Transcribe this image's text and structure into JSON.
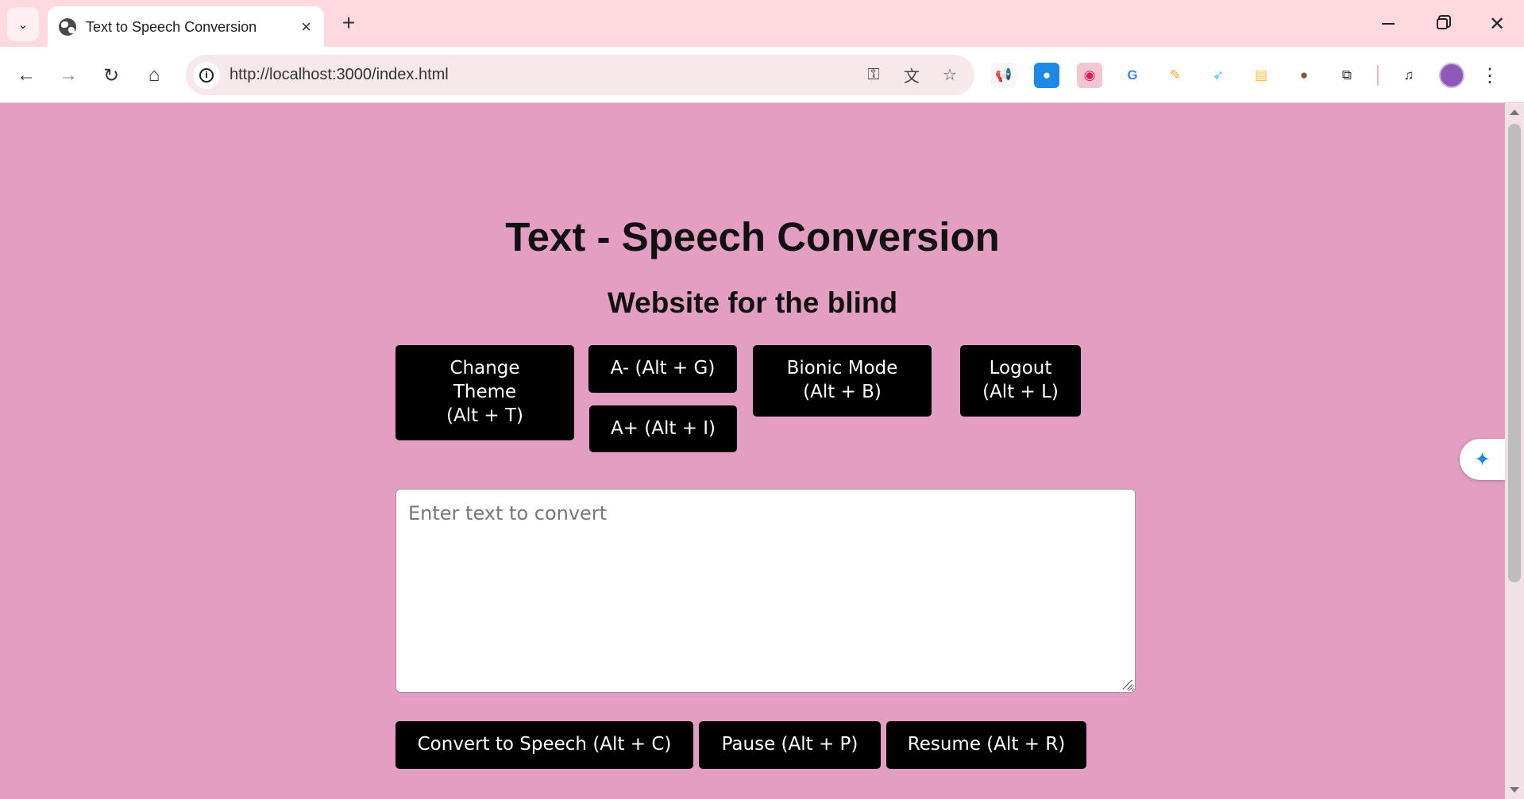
{
  "browser": {
    "tab_title": "Text to Speech Conversion",
    "url": "http://localhost:3000/index.html",
    "icons": {
      "tab_search": "chevron-down-icon",
      "close_tab": "close-icon",
      "new_tab": "plus-icon",
      "back": "arrow-left-icon",
      "forward": "arrow-right-icon",
      "reload": "reload-icon",
      "home": "home-icon",
      "site_info": "info-icon",
      "passwords": "key-icon",
      "translate": "translate-icon",
      "bookmark": "star-icon",
      "menu": "kebab-menu-icon"
    },
    "extensions": [
      {
        "name": "megaphone-extension-icon",
        "glyph": "📢",
        "color": "#ffffff"
      },
      {
        "name": "water-drop-extension-icon",
        "glyph": "💧",
        "color": "#1e88e5"
      },
      {
        "name": "lips-extension-icon",
        "glyph": "👄",
        "color": "#ffffff"
      },
      {
        "name": "google-translate-extension-icon",
        "glyph": "G",
        "color": "#4285f4"
      },
      {
        "name": "highlighter-extension-icon",
        "glyph": "🖍",
        "color": "#ffffff"
      },
      {
        "name": "bird-extension-icon",
        "glyph": "🐦",
        "color": "#ffffff"
      },
      {
        "name": "notes-extension-icon",
        "glyph": "📝",
        "color": "#ffffff"
      },
      {
        "name": "cookie-extension-icon",
        "glyph": "🍪",
        "color": "#ffffff"
      },
      {
        "name": "puzzle-extensions-icon",
        "glyph": "⧉",
        "color": "#ffffff"
      }
    ]
  },
  "page": {
    "background": "#e39fc2",
    "title": "Text - Speech Conversion",
    "subtitle": "Website for the blind",
    "buttons": {
      "change_theme": "Change\nTheme\n(Alt + T)",
      "font_decrease": "A- (Alt + G)",
      "font_increase": "A+ (Alt + I)",
      "bionic_mode": "Bionic Mode\n(Alt + B)",
      "logout": "Logout\n(Alt + L)",
      "convert": "Convert to Speech (Alt + C)",
      "pause": "Pause (Alt + P)",
      "resume": "Resume (Alt + R)"
    },
    "text_input": {
      "placeholder": "Enter text to convert",
      "value": ""
    },
    "floating_extension_icon": "sparkle-drop-icon"
  }
}
